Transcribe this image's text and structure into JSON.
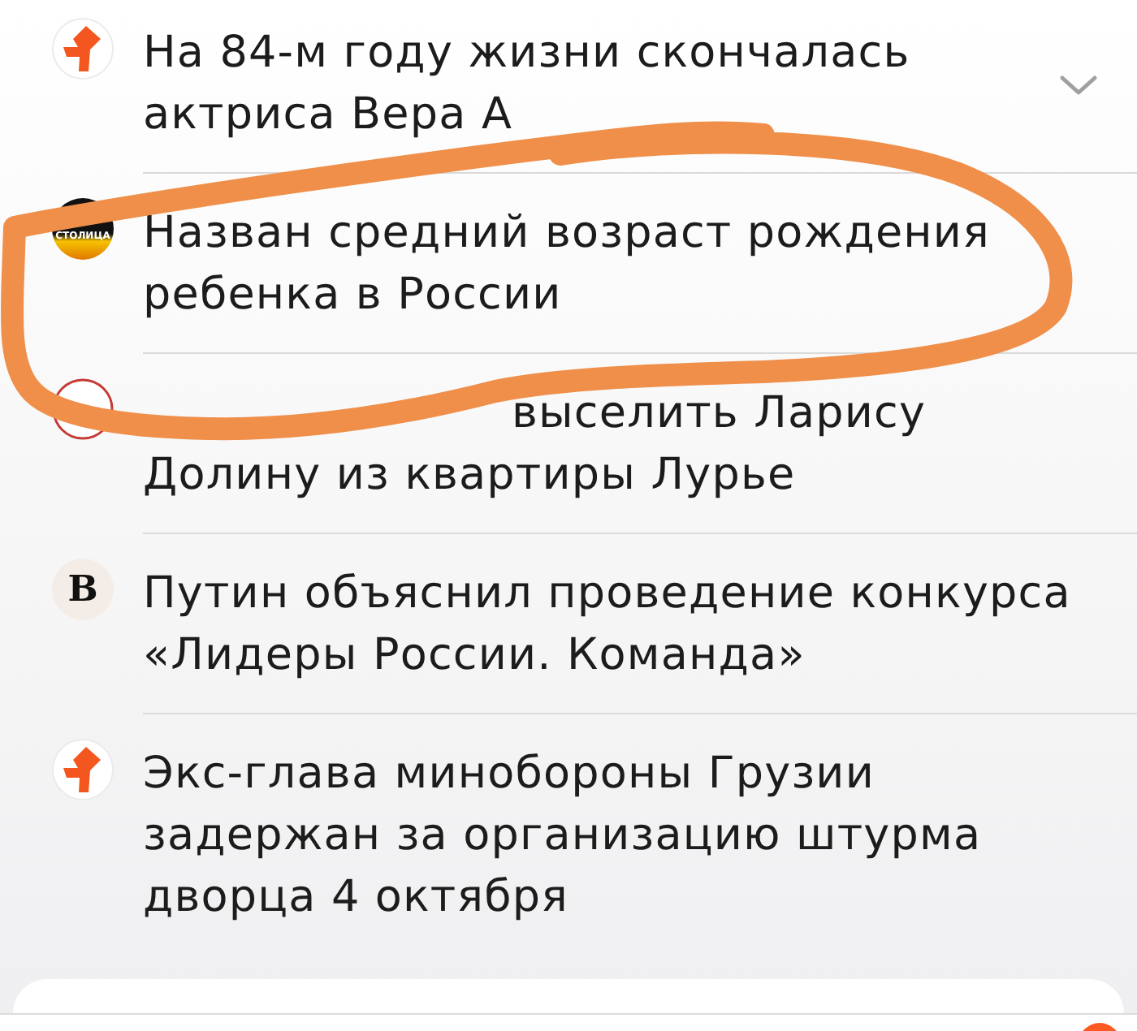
{
  "news": {
    "items": [
      {
        "source": {
          "kind": "ren"
        },
        "lines": [
          {
            "text": "На 84-м году жизни скончалась"
          },
          {
            "text": "актриса Вера А"
          }
        ],
        "circled": false
      },
      {
        "source": {
          "kind": "stolitsa",
          "logo_text": "СТОЛИЦА"
        },
        "lines": [
          {
            "text": "Назван средний возраст рождения"
          },
          {
            "text": "ребенка в России"
          }
        ],
        "circled": true
      },
      {
        "source": {
          "kind": "ring"
        },
        "lines": [
          {
            "text": "выселить Ларису",
            "lead_covered": true
          },
          {
            "text": "Долину из квартиры Лурье"
          }
        ],
        "circled": false
      },
      {
        "source": {
          "kind": "letter",
          "logo_text": "В"
        },
        "lines": [
          {
            "text": "Путин объяснил проведение конкурса"
          },
          {
            "text": "«Лидеры России. Команда»"
          }
        ],
        "circled": false
      },
      {
        "source": {
          "kind": "ren"
        },
        "lines": [
          {
            "text": "Экс-глава минобороны Грузии"
          },
          {
            "text": "задержан за организацию штурма"
          },
          {
            "text": "дворца 4 октября"
          }
        ],
        "circled": false
      }
    ]
  }
}
